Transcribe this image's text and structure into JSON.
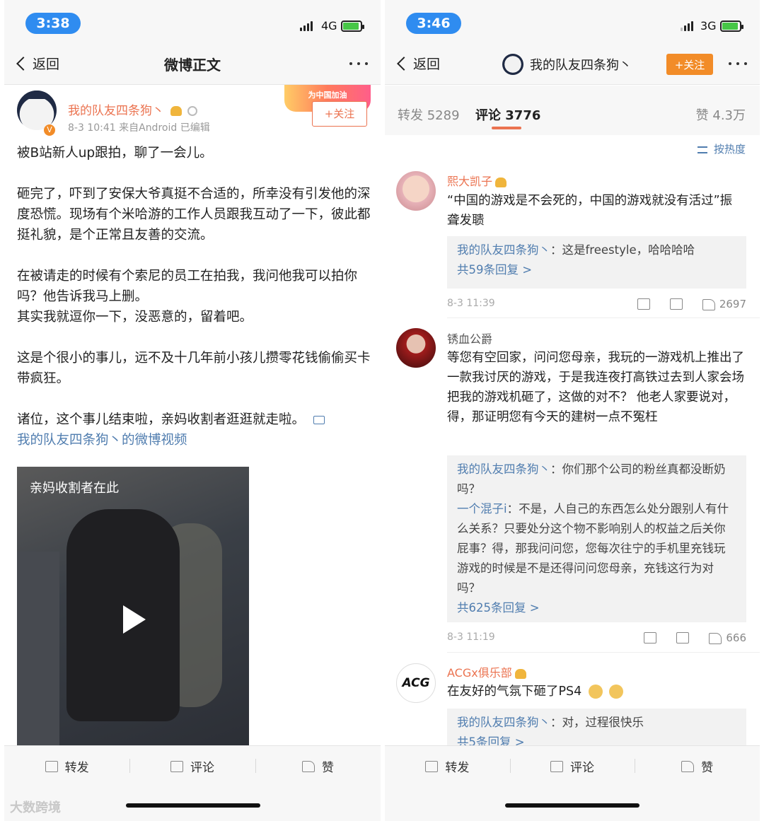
{
  "left": {
    "status": {
      "time": "3:38",
      "network": "4G"
    },
    "nav": {
      "back_label": "返回",
      "title": "微博正文"
    },
    "post": {
      "author": "我的队友四条狗丶",
      "meta": "8-3 10:41  来自Android  已编辑",
      "banner": "为中国加油",
      "follow": "+关注",
      "paragraphs": [
        "被B站新人up跟拍，聊了一会儿。",
        "砸完了，吓到了安保大爷真挺不合适的，所幸没有引发他的深度恐慌。现场有个米哈游的工作人员跟我互动了一下，彼此都挺礼貌，是个正常且友善的交流。",
        "在被请走的时候有个索尼的员工在拍我，我问他我可以拍你吗？他告诉我马上删。\n其实我就逗你一下，没恶意的，留着吧。",
        "这是个很小的事儿，远不及十几年前小孩儿攒零花钱偷偷买卡带疯狂。"
      ],
      "last_paragraph": "诸位，这个事儿结束啦，亲妈收割者逛逛就走啦。",
      "video_link": "我的队友四条狗丶的微博视频",
      "video_label": "亲妈收割者在此"
    },
    "toolbar": {
      "repost": "转发",
      "comment": "评论",
      "like": "赞"
    },
    "watermark": "大数跨境"
  },
  "right": {
    "status": {
      "time": "3:46",
      "network": "3G"
    },
    "nav": {
      "back_label": "返回",
      "title": "我的队友四条狗丶",
      "follow": "+关注"
    },
    "tabs": {
      "repost": "转发 5289",
      "comment": "评论 3776",
      "like": "赞 4.3万"
    },
    "sort": "按热度",
    "comments": [
      {
        "name": "熙大凯子",
        "text": "“中国的游戏是不会死的，中国的游戏就没有活过”振聋发聩",
        "replies": [
          {
            "name": "我的队友四条狗丶",
            "text": "：这是freestyle，哈哈哈哈"
          }
        ],
        "more": "共59条回复 >",
        "time": "8-3 11:39",
        "likes": "2697"
      },
      {
        "name": "锈血公爵",
        "text": "等您有空回家，问问您母亲，我玩的一游戏机上推出了一款我讨厌的游戏，于是我连夜打高铁过去到人家会场把我的游戏机砸了，这做的对不？ 他老人家要说对，得，那证明您有今天的建树一点不冤枉",
        "replies": [
          {
            "name": "我的队友四条狗丶",
            "text": "：你们那个公司的粉丝真都没断奶吗？"
          },
          {
            "name": "一个混子i",
            "text": "：不是，人自己的东西怎么处分跟别人有什么关系？只要处分这个物不影响别人的权益之后关你屁事？得，那我问问您，您每次往宁的手机里充钱玩游戏的时候是不是还得问问您母亲，充钱这行为对吗？"
          }
        ],
        "more": "共625条回复 >",
        "time": "8-3 11:19",
        "likes": "666"
      },
      {
        "name": "ACGx俱乐部",
        "text": "在友好的气氛下砸了PS4",
        "replies": [
          {
            "name": "我的队友四条狗丶",
            "text": "：对，过程很快乐"
          }
        ],
        "more": "共5条回复 >"
      }
    ],
    "toolbar": {
      "repost": "转发",
      "comment": "评论",
      "like": "赞"
    }
  }
}
